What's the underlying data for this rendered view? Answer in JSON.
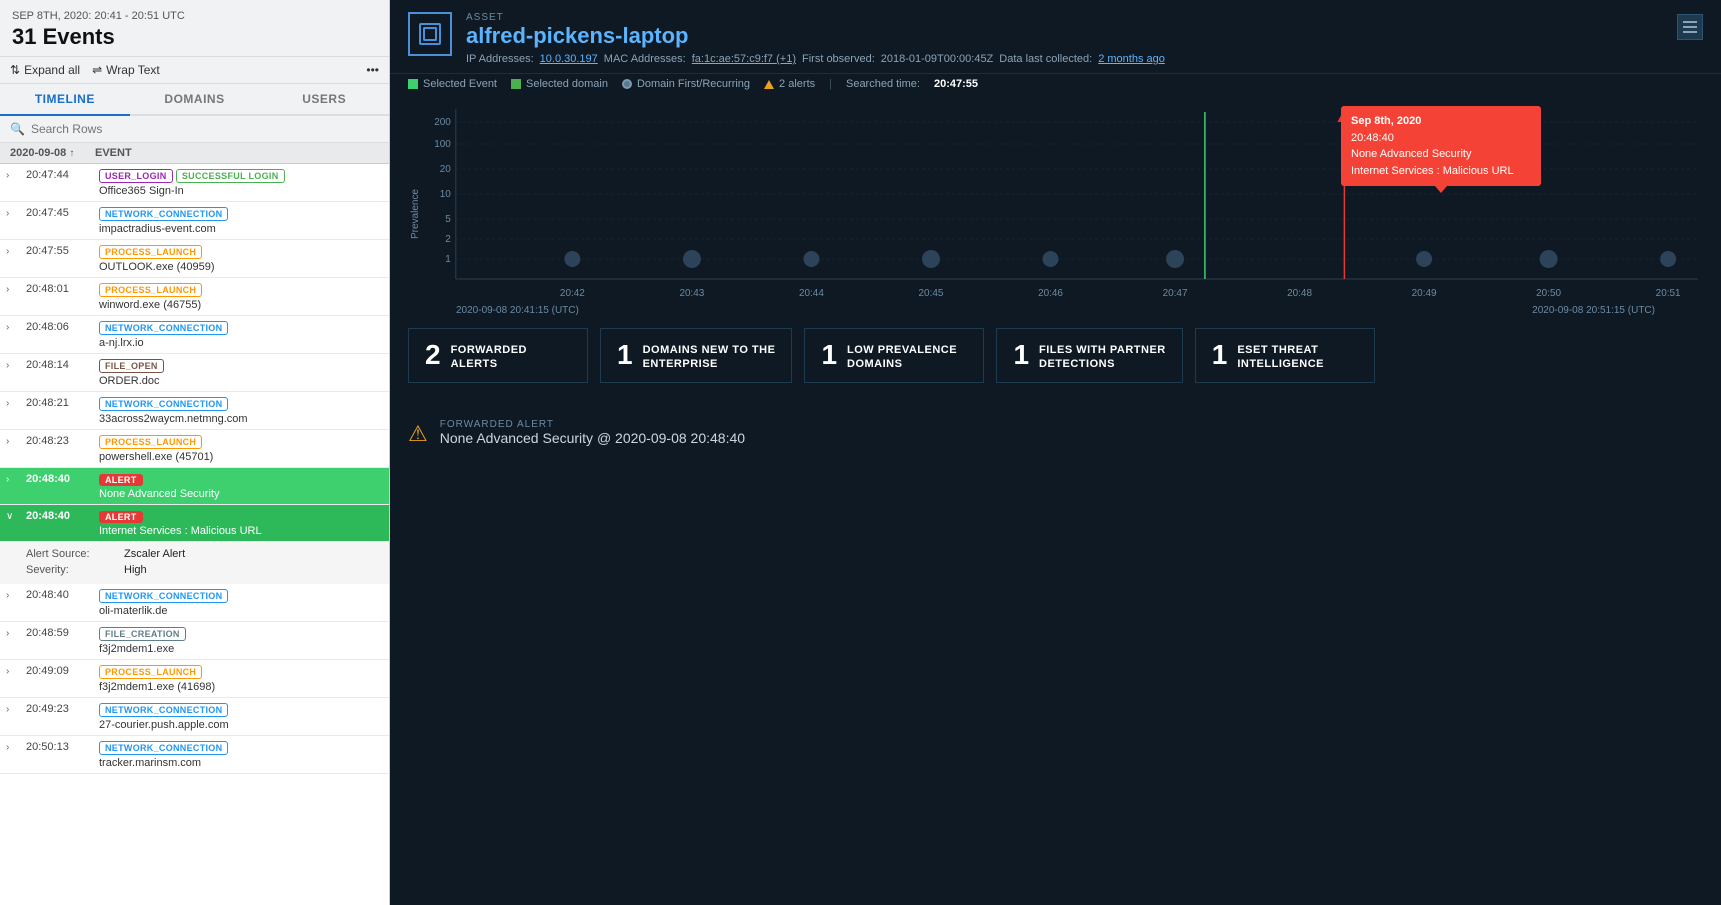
{
  "left": {
    "date_range": "SEP 8TH, 2020: 20:41 - 20:51 UTC",
    "event_count": "31 Events",
    "toolbar": {
      "expand_all": "Expand all",
      "wrap_text": "Wrap Text"
    },
    "tabs": [
      "TIMELINE",
      "DOMAINS",
      "USERS"
    ],
    "active_tab": "TIMELINE",
    "search_placeholder": "Search Rows",
    "col_date": "2020-09-08",
    "col_event": "EVENT",
    "events": [
      {
        "time": "20:47:44",
        "tags": [
          {
            "label": "USER_LOGIN",
            "type": "user-login"
          },
          {
            "label": "SUCCESSFUL LOGIN",
            "type": "success"
          }
        ],
        "desc": "Office365 Sign-In",
        "selected": false,
        "expanded": false
      },
      {
        "time": "20:47:45",
        "tags": [
          {
            "label": "NETWORK_CONNECTION",
            "type": "network"
          }
        ],
        "desc": "impactradius-event.com",
        "selected": false,
        "expanded": false
      },
      {
        "time": "20:47:55",
        "tags": [
          {
            "label": "PROCESS_LAUNCH",
            "type": "process"
          }
        ],
        "desc": "OUTLOOK.exe (40959)",
        "selected": false,
        "expanded": false
      },
      {
        "time": "20:48:01",
        "tags": [
          {
            "label": "PROCESS_LAUNCH",
            "type": "process"
          }
        ],
        "desc": "winword.exe (46755)",
        "selected": false,
        "expanded": false
      },
      {
        "time": "20:48:06",
        "tags": [
          {
            "label": "NETWORK_CONNECTION",
            "type": "network"
          }
        ],
        "desc": "a-nj.lrx.io",
        "selected": false,
        "expanded": false
      },
      {
        "time": "20:48:14",
        "tags": [
          {
            "label": "FILE_OPEN",
            "type": "file-open"
          }
        ],
        "desc": "ORDER.doc",
        "selected": false,
        "expanded": false
      },
      {
        "time": "20:48:21",
        "tags": [
          {
            "label": "NETWORK_CONNECTION",
            "type": "network"
          }
        ],
        "desc": "33across2waycm.netmng.com",
        "selected": false,
        "expanded": false
      },
      {
        "time": "20:48:23",
        "tags": [
          {
            "label": "PROCESS_LAUNCH",
            "type": "process"
          }
        ],
        "desc": "powershell.exe (45701)",
        "selected": false,
        "expanded": false
      },
      {
        "time": "20:48:40",
        "tags": [
          {
            "label": "ALERT",
            "type": "alert"
          }
        ],
        "desc": "None Advanced Security",
        "selected": true,
        "expanded": false
      },
      {
        "time": "20:48:40",
        "tags": [
          {
            "label": "ALERT",
            "type": "alert"
          }
        ],
        "desc": "Internet Services : Malicious URL",
        "selected": true,
        "expanded": true,
        "details": [
          {
            "label": "Alert Source:",
            "value": "Zscaler Alert"
          },
          {
            "label": "Severity:",
            "value": "High"
          }
        ]
      },
      {
        "time": "20:48:40",
        "tags": [
          {
            "label": "NETWORK_CONNECTION",
            "type": "network"
          }
        ],
        "desc": "oli-materlik.de",
        "selected": false,
        "expanded": false
      },
      {
        "time": "20:48:59",
        "tags": [
          {
            "label": "FILE_CREATION",
            "type": "file-create"
          }
        ],
        "desc": "f3j2mdem1.exe",
        "selected": false,
        "expanded": false
      },
      {
        "time": "20:49:09",
        "tags": [
          {
            "label": "PROCESS_LAUNCH",
            "type": "process"
          }
        ],
        "desc": "f3j2mdem1.exe (41698)",
        "selected": false,
        "expanded": false
      },
      {
        "time": "20:49:23",
        "tags": [
          {
            "label": "NETWORK_CONNECTION",
            "type": "network"
          }
        ],
        "desc": "27-courier.push.apple.com",
        "selected": false,
        "expanded": false
      },
      {
        "time": "20:50:13",
        "tags": [
          {
            "label": "NETWORK_CONNECTION",
            "type": "network"
          }
        ],
        "desc": "tracker.marinsm.com",
        "selected": false,
        "expanded": false
      }
    ]
  },
  "right": {
    "asset_type": "ASSET",
    "asset_name": "alfred-pickens-laptop",
    "asset_icon": "⬜",
    "meta": {
      "ip_label": "IP Addresses:",
      "ip": "10.0.30.197",
      "mac_label": "MAC Addresses:",
      "mac": "fa:1c:ae:57:c9:f7",
      "mac_extra": "(+1)",
      "first_obs_label": "First observed:",
      "first_obs": "2018-01-09T00:00:45Z",
      "data_label": "Data last collected:",
      "data_collected": "2 months ago"
    },
    "legend": {
      "selected_event": "Selected Event",
      "selected_domain": "Selected domain",
      "domain_first": "Domain First/Recurring",
      "alerts": "2 alerts",
      "searched_time_label": "Searched time:",
      "searched_time": "20:47:55"
    },
    "tooltip": {
      "date": "Sep 8th, 2020",
      "time": "20:48:40",
      "line1": "None Advanced Security",
      "line2": "Internet Services : Malicious URL"
    },
    "chart": {
      "x_start": "2020-09-08 20:41:15 (UTC)",
      "x_end": "2020-09-08 20:51:15 (UTC)",
      "x_labels": [
        "20:42",
        "20:43",
        "20:44",
        "20:45",
        "20:46",
        "20:47",
        "20:48",
        "20:49",
        "20:50",
        "20:51"
      ],
      "y_labels": [
        "1",
        "2",
        "5",
        "10",
        "20",
        "100",
        "200"
      ],
      "prevalence_label": "Prevalence"
    },
    "metrics": [
      {
        "num": "2",
        "label": "FORWARDED\nALERTS"
      },
      {
        "num": "1",
        "label": "DOMAINS NEW TO THE\nENTERPRISE"
      },
      {
        "num": "1",
        "label": "LOW PREVALENCE\nDOMAINS"
      },
      {
        "num": "1",
        "label": "FILES WITH PARTNER\nDETECTIONS"
      },
      {
        "num": "1",
        "label": "ESET THREAT\nINTELLIGENCE"
      }
    ],
    "alert": {
      "type_label": "FORWARDED ALERT",
      "description": "None Advanced Security @ 2020-09-08 20:48:40"
    }
  }
}
